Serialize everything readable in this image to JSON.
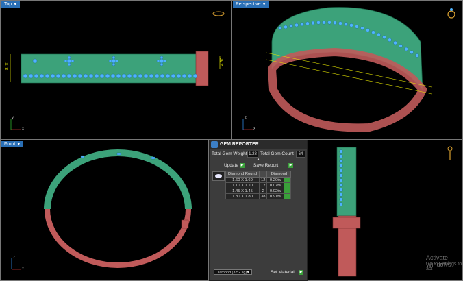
{
  "viewports": {
    "top": {
      "label": "Top",
      "axes": {
        "y": "y",
        "x": "x"
      }
    },
    "perspective": {
      "label": "Perspective",
      "axes": {
        "z": "z",
        "x": "x"
      }
    },
    "front": {
      "label": "Front",
      "axes": {
        "z": "z",
        "x": "x"
      }
    },
    "right": {
      "label": "",
      "axes": {
        "z": "z",
        "y": "y"
      }
    }
  },
  "dimensions": {
    "height_mm": "8.00",
    "width_mm": "4.30"
  },
  "gem_reporter": {
    "title": "GEM REPORTER",
    "total_weight_label": "Total Gem Weight",
    "total_weight": "1.28",
    "total_count_label": "Total Gem Count",
    "total_count": "64",
    "update_label": "Update",
    "save_label": "Save Report",
    "columns": [
      "Diamond Round",
      "",
      "Diamond"
    ],
    "rows": [
      {
        "size": "1.60 X 1.60",
        "count": "12",
        "weight": "0.20tw"
      },
      {
        "size": "1.10 X 1.10",
        "count": "12",
        "weight": "0.07tw"
      },
      {
        "size": "1.45 X 1.45",
        "count": "2",
        "weight": "0.02tw"
      },
      {
        "size": "1.80 X 1.80",
        "count": "38",
        "weight": "0.91tw"
      }
    ],
    "material_value": "Diamond   (3.52 sg)",
    "set_material_label": "Set Material"
  },
  "watermark": {
    "line1": "Activate Windows",
    "line2": "Go to Settings to act"
  },
  "colors": {
    "green": "#3ca27a",
    "red": "#c05a5a",
    "gem": "#4fb3ff",
    "accent": "#2a6fb5"
  }
}
